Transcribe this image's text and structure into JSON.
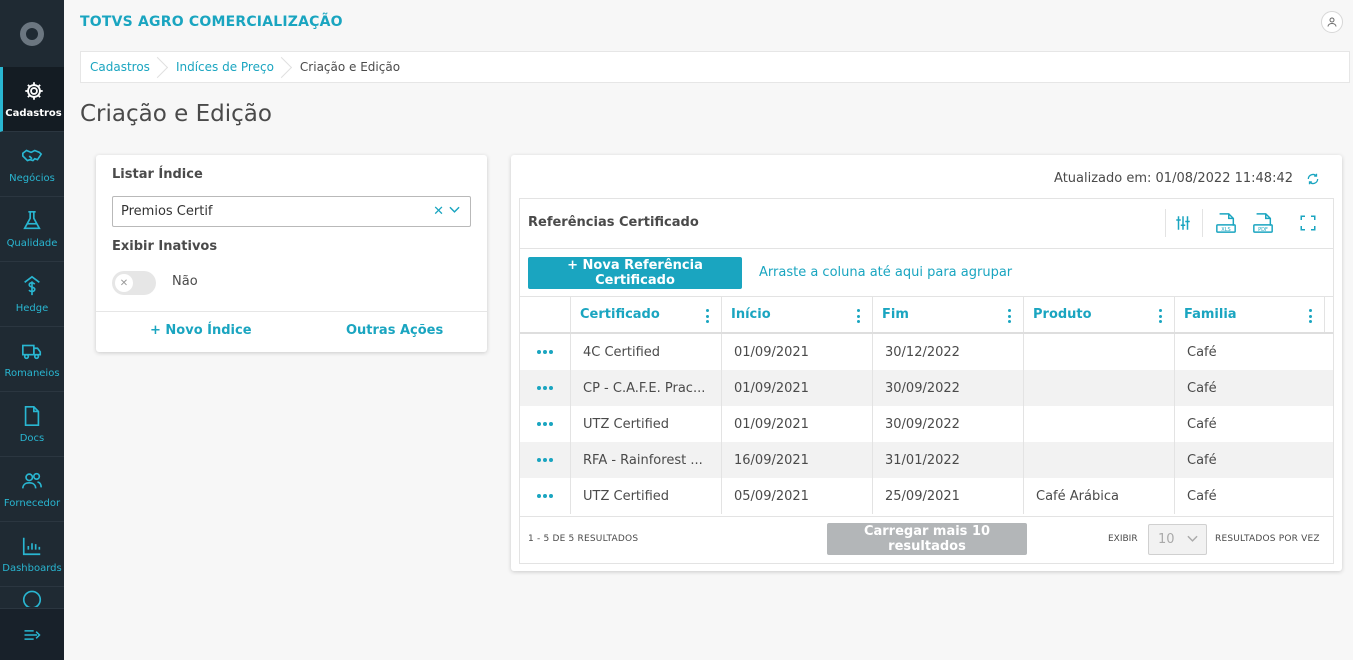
{
  "app": {
    "title": "TOTVS AGRO COMERCIALIZAÇÃO"
  },
  "sidebar": {
    "items": [
      {
        "label": "Cadastros",
        "icon": "gear-icon"
      },
      {
        "label": "Negócios",
        "icon": "handshake-icon"
      },
      {
        "label": "Qualidade",
        "icon": "flask-icon"
      },
      {
        "label": "Hedge",
        "icon": "dollar-arrow-icon"
      },
      {
        "label": "Romaneios",
        "icon": "truck-icon"
      },
      {
        "label": "Docs",
        "icon": "document-icon"
      },
      {
        "label": "Fornecedor",
        "icon": "users-icon"
      },
      {
        "label": "Dashboards",
        "icon": "bar-chart-icon"
      }
    ]
  },
  "breadcrumb": {
    "items": [
      "Cadastros",
      "Indíces de Preço",
      "Criação e Edição"
    ]
  },
  "page": {
    "title": "Criação e Edição"
  },
  "left_panel": {
    "list_label": "Listar Índice",
    "selected_index": "Premios Certif",
    "inactive_label": "Exibir Inativos",
    "inactive_value": "Não",
    "new_index": "+ Novo Índice",
    "other_actions": "Outras Ações"
  },
  "right_panel": {
    "updated": "Atualizado em: 01/08/2022 11:48:42",
    "grid_title": "Referências Certificado",
    "add_button": "+ Nova Referência Certificado",
    "group_hint": "Arraste a coluna até aqui para agrupar",
    "columns": [
      "Certificado",
      "Início",
      "Fim",
      "Produto",
      "Familia"
    ],
    "rows": [
      [
        "4C Certified",
        "01/09/2021",
        "30/12/2022",
        "",
        "Café"
      ],
      [
        "CP - C.A.F.E. Prac...",
        "01/09/2021",
        "30/09/2022",
        "",
        "Café"
      ],
      [
        "UTZ Certified",
        "01/09/2021",
        "30/09/2022",
        "",
        "Café"
      ],
      [
        "RFA - Rainforest ...",
        "16/09/2021",
        "31/01/2022",
        "",
        "Café"
      ],
      [
        "UTZ Certified",
        "05/09/2021",
        "25/09/2021",
        "Café Arábica",
        "Café"
      ]
    ],
    "result_count": "1 - 5 DE 5 RESULTADOS",
    "load_more": "Carregar mais 10 resultados",
    "show_label": "EXIBIR",
    "page_size": "10",
    "per_time": "RESULTADOS POR VEZ"
  },
  "colors": {
    "accent": "#1aa5c0",
    "sidebar": "#1f2a33"
  }
}
